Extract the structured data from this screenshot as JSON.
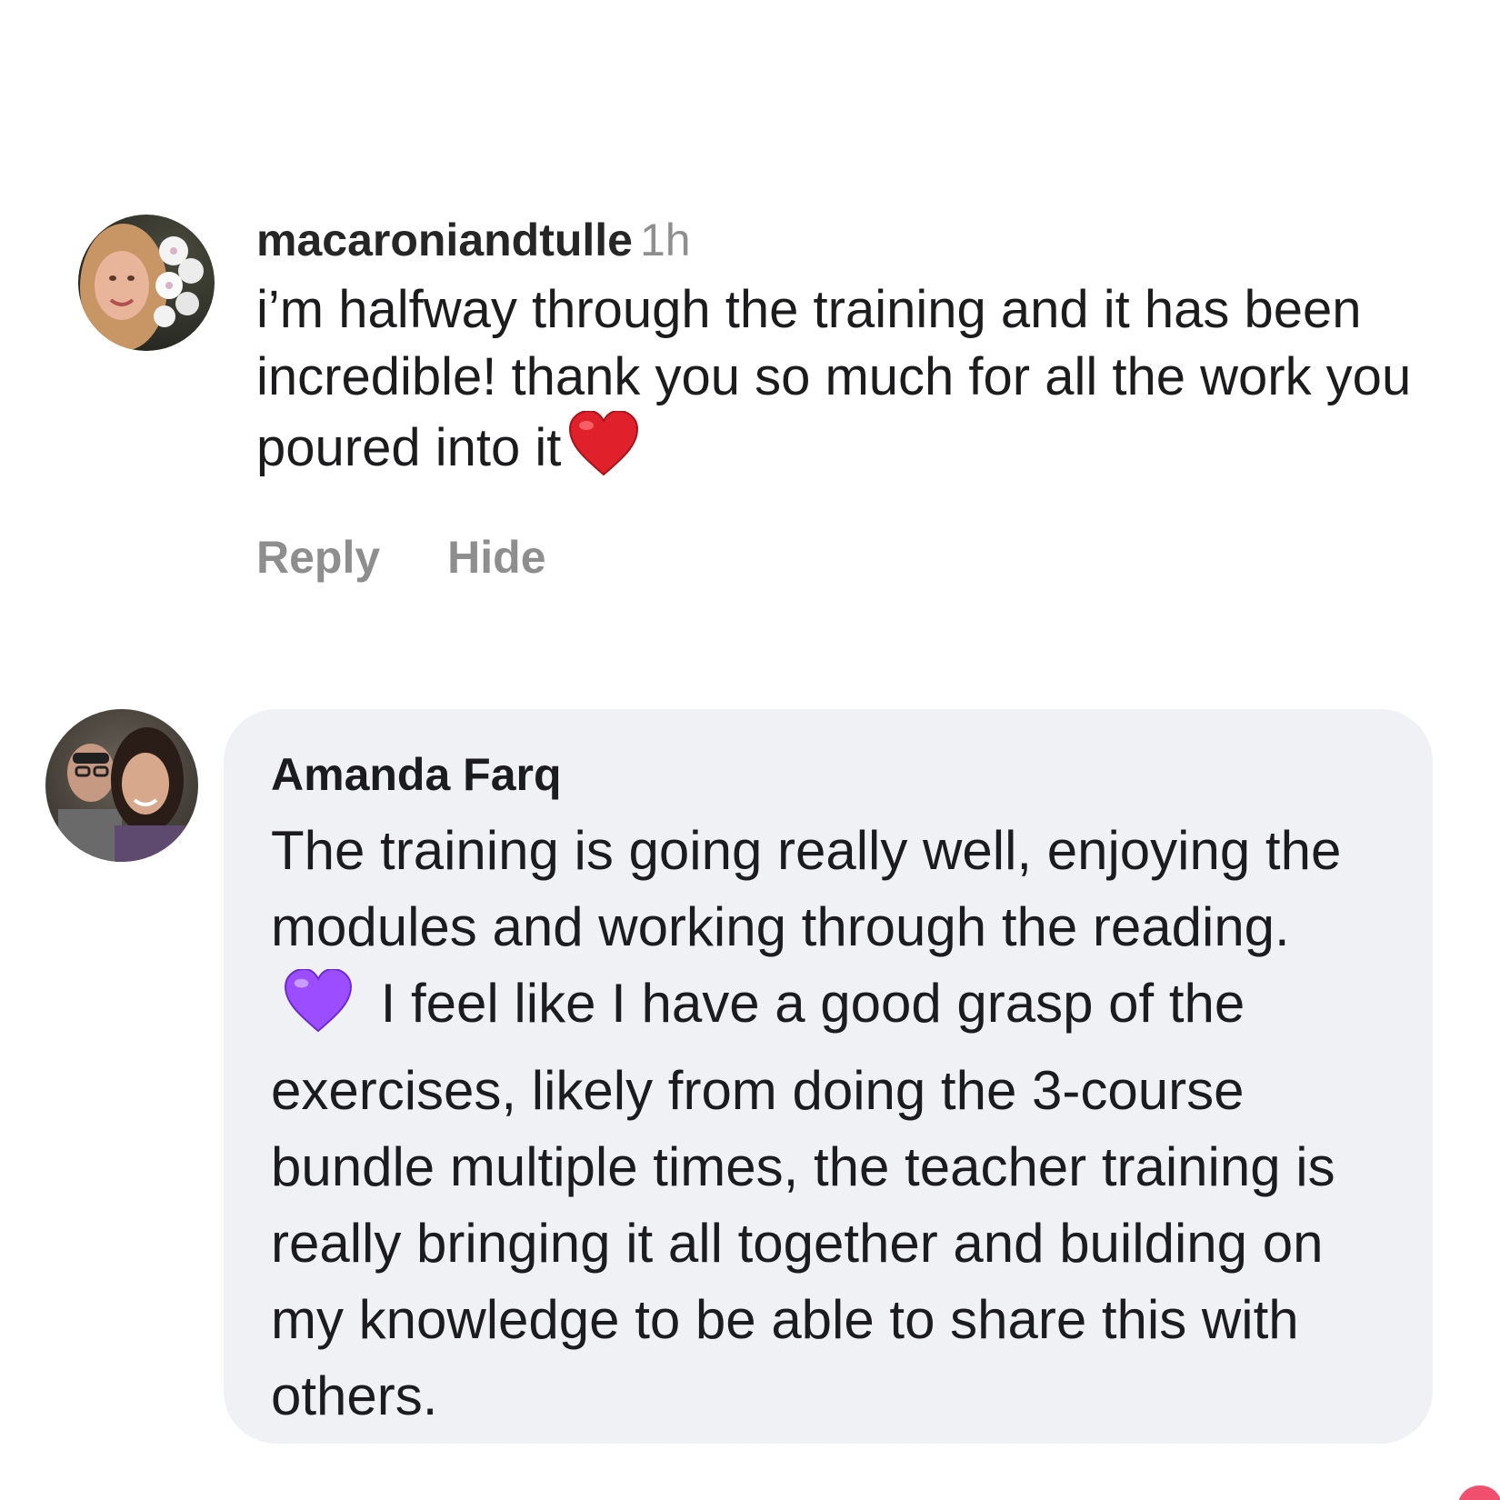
{
  "comments": [
    {
      "username": "macaroniandtulle",
      "time": "1h",
      "text": "i’m halfway through the training and it has been incredible! thank you so much for all the work you poured into it",
      "emoji": "red-heart",
      "actions": {
        "reply": "Reply",
        "hide": "Hide"
      }
    },
    {
      "name": "Amanda Farq",
      "text_before": "The training is going really well, enjoying the modules and working through the reading.",
      "emoji": "purple-heart",
      "text_after": "I feel like I have a good grasp of the exercises, likely from doing the 3-course bundle multiple times, the teacher training is really bringing it all together and building on my knowledge to be able to share this with others."
    }
  ],
  "colors": {
    "bubble_bg": "#f0f1f5",
    "muted_text": "#8e8e8e",
    "primary_text": "#1c1c1e",
    "red_heart": "#e0202a",
    "purple_heart": "#9b4dff"
  }
}
